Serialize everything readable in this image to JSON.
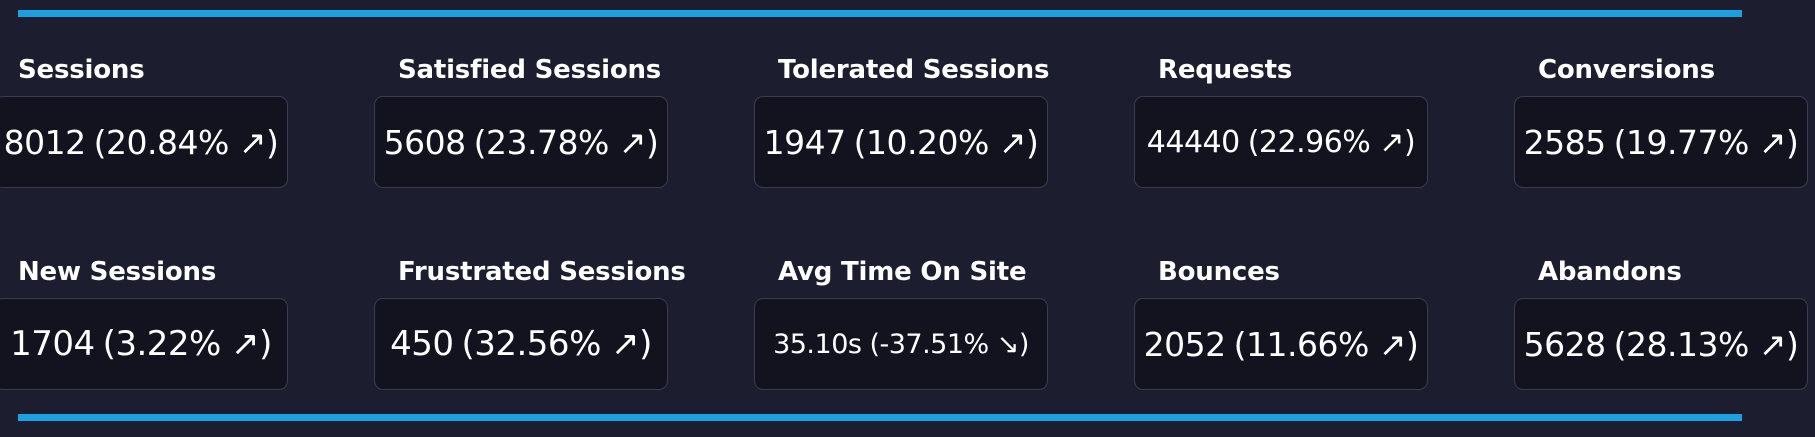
{
  "metrics": [
    {
      "label": "Sessions",
      "value": "8012",
      "change": "(20.84% ↗)"
    },
    {
      "label": "Satisfied Sessions",
      "value": "5608",
      "change": "(23.78% ↗)"
    },
    {
      "label": "Tolerated Sessions",
      "value": "1947",
      "change": "(10.20% ↗)"
    },
    {
      "label": "Requests",
      "value": "44440",
      "change": "(22.96% ↗)"
    },
    {
      "label": "Conversions",
      "value": "2585",
      "change": "(19.77% ↗)"
    },
    {
      "label": "New Sessions",
      "value": "1704",
      "change": "(3.22% ↗)"
    },
    {
      "label": "Frustrated Sessions",
      "value": "450",
      "change": "(32.56% ↗)"
    },
    {
      "label": "Avg Time On Site",
      "value": "35.10s",
      "change": "(-37.51% ↘)"
    },
    {
      "label": "Bounces",
      "value": "2052",
      "change": "(11.66% ↗)"
    },
    {
      "label": "Abandons",
      "value": "5628",
      "change": "(28.13% ↗)"
    }
  ],
  "colors": {
    "background": "#1c1d2f",
    "card_background": "#12131f",
    "card_border": "#3a3c52",
    "accent_rule": "#1ba1e2",
    "text": "#ffffff"
  }
}
